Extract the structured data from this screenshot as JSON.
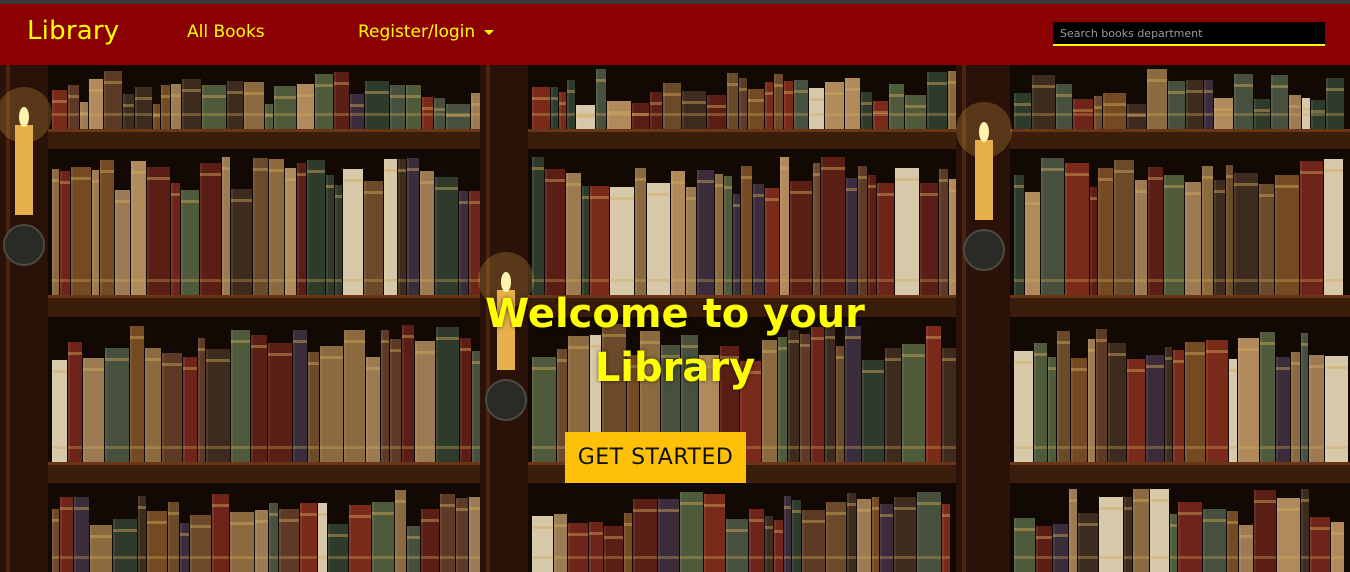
{
  "navbar": {
    "brand": "Library",
    "links": [
      {
        "label": "All Books"
      },
      {
        "label": "Register/login"
      }
    ],
    "search": {
      "placeholder": "Search books department",
      "value": ""
    }
  },
  "hero": {
    "headline": "Welcome to your Library",
    "cta_label": "GET STARTED",
    "background": "bookshelf-with-candles-image"
  },
  "colors": {
    "navbar": "#8b0000",
    "accent": "#ffff00",
    "cta": "#ffc107",
    "search_bg": "#000000"
  }
}
